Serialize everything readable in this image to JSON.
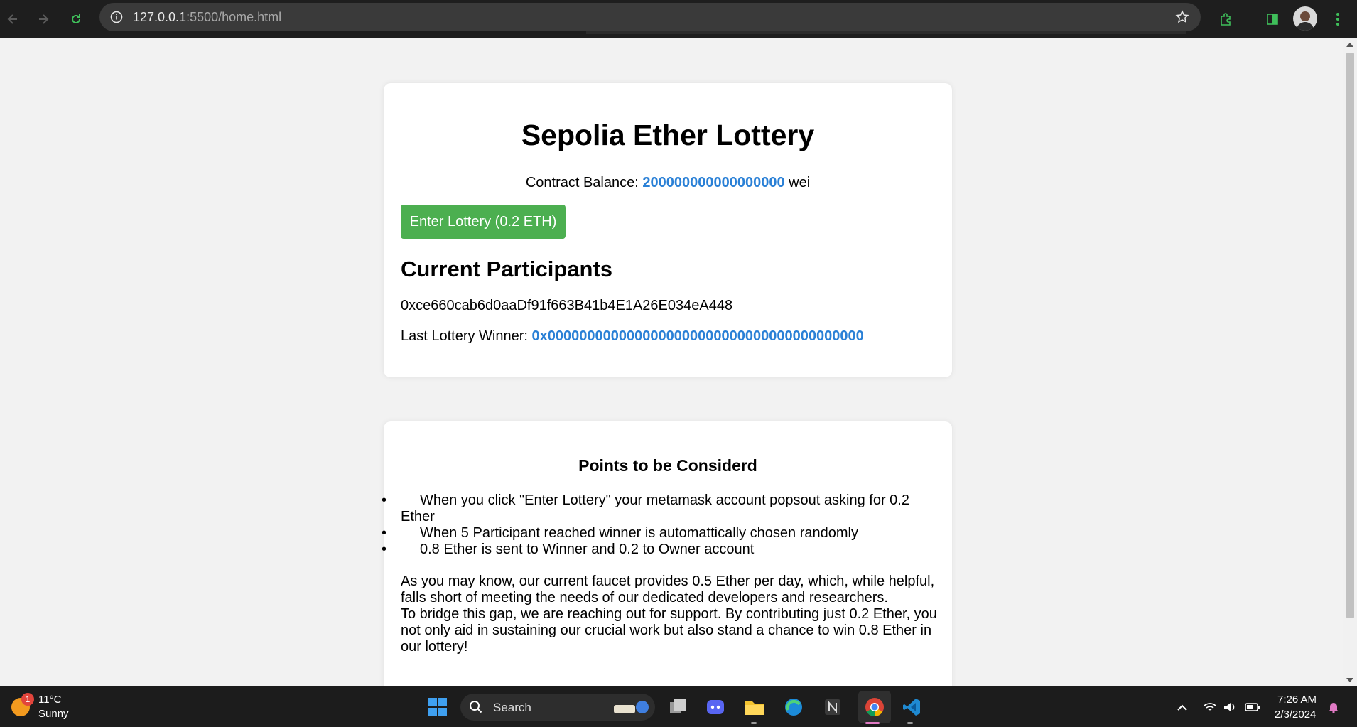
{
  "browser": {
    "url_host": "127.0.0.1",
    "url_path": ":5500/home.html",
    "icons": [
      "back-icon",
      "forward-icon",
      "reload-icon",
      "site-info-icon",
      "bookmark-star-icon",
      "extensions-icon",
      "side-panel-icon",
      "profile-avatar",
      "menu-icon"
    ]
  },
  "page": {
    "title": "Sepolia Ether Lottery",
    "balance_label": "Contract Balance: ",
    "balance_value": "200000000000000000",
    "balance_unit": " wei",
    "enter_button_label": "Enter Lottery (0.2 ETH)",
    "participants_heading": "Current Participants",
    "participants": [
      "0xce660cab6d0aaDf91f663B41b4E1A26E034eA448"
    ],
    "winner_label": "Last Lottery Winner: ",
    "winner_value": "0x0000000000000000000000000000000000000000",
    "points_heading": "Points to be Considerd",
    "points": [
      "When you click \"Enter Lottery\" your metamask account popsout asking for 0.2 Ether",
      "When 5 Participant reached winner is automattically chosen randomly",
      "0.8 Ether is sent to Winner and 0.2 to Owner account"
    ],
    "paragraph_1": "As you may know, our current faucet provides 0.5 Ether per day, which, while helpful, falls short of meeting the needs of our dedicated developers and researchers.",
    "paragraph_2": "To bridge this gap, we are reaching out for support. By contributing just 0.2 Ether, you not only aid in sustaining our crucial work but also stand a chance to win 0.8 Ether in our lottery!"
  },
  "colors": {
    "accent_blue": "#2a80d6",
    "button_green": "#4caf50"
  },
  "taskbar": {
    "weather_badge": "1",
    "temperature": "11°C",
    "condition": "Sunny",
    "search_label": "Search",
    "time": "7:26 AM",
    "date": "2/3/2024",
    "apps": [
      "windows-start-icon",
      "search-icon",
      "task-view-icon",
      "discord-icon",
      "file-explorer-icon",
      "edge-icon",
      "notion-icon",
      "chrome-icon",
      "vscode-icon"
    ],
    "tray": [
      "chevron-up-icon",
      "wifi-icon",
      "volume-icon",
      "battery-icon",
      "notification-bell-icon"
    ]
  }
}
